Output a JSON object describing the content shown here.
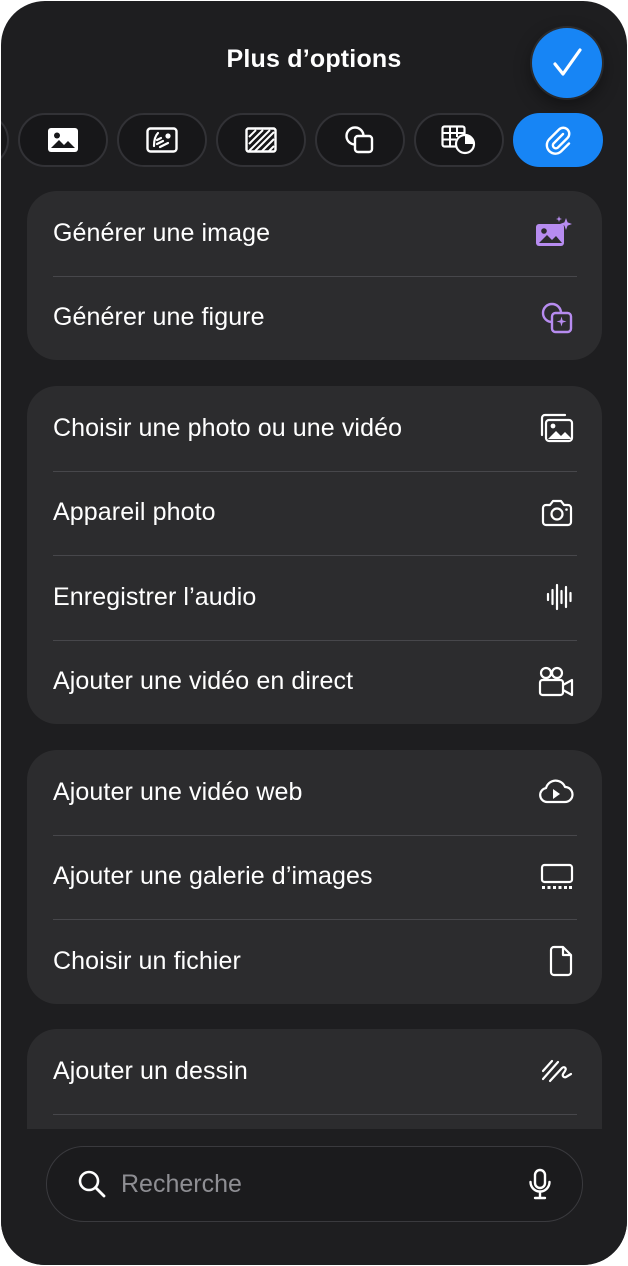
{
  "header": {
    "title": "Plus d’options"
  },
  "tabs": [
    {
      "icon": "partial-tab-icon"
    },
    {
      "icon": "image-icon"
    },
    {
      "icon": "media-placeholder-icon"
    },
    {
      "icon": "texture-icon"
    },
    {
      "icon": "shapes-icon"
    },
    {
      "icon": "table-chart-icon"
    },
    {
      "icon": "paperclip-icon",
      "active": true
    }
  ],
  "groups": [
    {
      "items": [
        {
          "label": "Générer une image",
          "icon": "generate-image-icon"
        },
        {
          "label": "Générer une figure",
          "icon": "generate-figure-icon"
        }
      ]
    },
    {
      "items": [
        {
          "label": "Choisir une photo ou une vidéo",
          "icon": "photo-library-icon"
        },
        {
          "label": "Appareil photo",
          "icon": "camera-icon"
        },
        {
          "label": "Enregistrer l’audio",
          "icon": "waveform-icon"
        },
        {
          "label": "Ajouter une vidéo en direct",
          "icon": "live-video-icon"
        }
      ]
    },
    {
      "items": [
        {
          "label": "Ajouter une vidéo web",
          "icon": "cloud-play-icon"
        },
        {
          "label": "Ajouter une galerie d’images",
          "icon": "image-gallery-icon"
        },
        {
          "label": "Choisir un fichier",
          "icon": "document-icon"
        }
      ]
    },
    {
      "items": [
        {
          "label": "Ajouter un dessin",
          "icon": "scribble-icon"
        }
      ]
    }
  ],
  "search": {
    "placeholder": "Recherche"
  },
  "colors": {
    "accent": "#1785f5",
    "ai_purple": "#b78cf0",
    "background": "#1e1e20",
    "card": "#2c2c2e"
  }
}
